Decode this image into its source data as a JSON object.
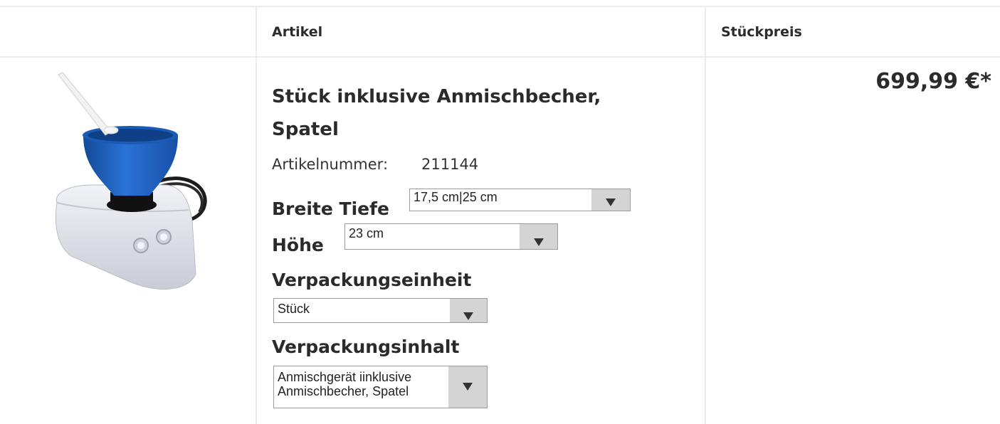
{
  "table": {
    "headers": {
      "image": "",
      "article": "Artikel",
      "price": "Stückpreis"
    }
  },
  "product": {
    "image_alt": "Anmischgerät mit Anmischbecher und Spatel",
    "title": "Stück inklusive Anmischbecher, Spatel",
    "article_number_label": "Artikelnummer:",
    "article_number": "211144",
    "price": "699,99 €*",
    "options": {
      "dimensions": {
        "label_line1": "Breite Tiefe",
        "value": "17,5 cm|25 cm"
      },
      "height": {
        "label": "Höhe",
        "value": "23 cm"
      },
      "packaging_unit": {
        "label": "Verpackungseinheit",
        "value": "Stück"
      },
      "packaging_content": {
        "label": "Verpackungsinhalt",
        "value_line1": "Anmischgerät iinklusive",
        "value_line2": "Anmischbecher, Spatel"
      }
    }
  },
  "colors": {
    "funnel": "#1f63c4",
    "base": "#dfe1e8",
    "border": "#ececec"
  }
}
